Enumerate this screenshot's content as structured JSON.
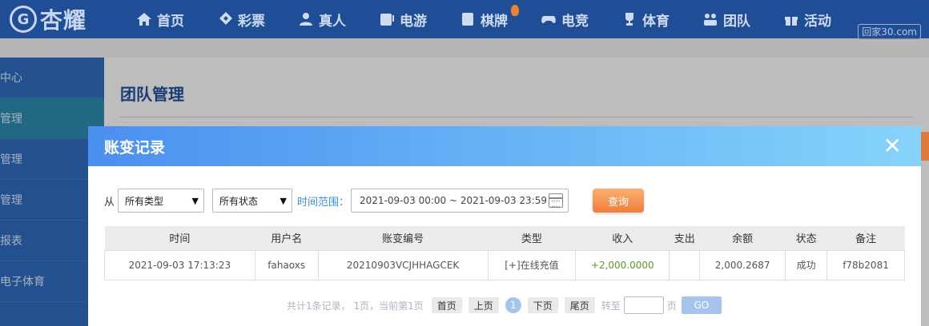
{
  "logo": {
    "text": "杏耀",
    "mark": "G"
  },
  "nav": [
    {
      "label": "首页",
      "icon": "home-icon"
    },
    {
      "label": "彩票",
      "icon": "ticket-icon"
    },
    {
      "label": "真人",
      "icon": "person-icon"
    },
    {
      "label": "电游",
      "icon": "slot-machine-icon"
    },
    {
      "label": "棋牌",
      "icon": "card-icon"
    },
    {
      "label": "电竞",
      "icon": "gamepad-icon"
    },
    {
      "label": "体育",
      "icon": "trophy-icon"
    },
    {
      "label": "团队",
      "icon": "team-icon"
    },
    {
      "label": "活动",
      "icon": "gift-icon"
    }
  ],
  "watermark": "回家30.com",
  "sidebar": {
    "items": [
      {
        "label": "理中心"
      },
      {
        "label": "队管理"
      },
      {
        "label": "人管理"
      },
      {
        "label": "表管理"
      },
      {
        "label": "票报表"
      },
      {
        "label": "人电子体育"
      }
    ]
  },
  "main": {
    "title": "团队管理"
  },
  "modal": {
    "title": "账变记录",
    "close": "✕",
    "filters": {
      "from_label": "从",
      "type_value": "所有类型",
      "status_value": "所有状态",
      "range_label": "时间范围：",
      "date_range": "2021-09-03 00:00 ~ 2021-09-03 23:59",
      "query_label": "查询"
    },
    "table": {
      "columns": [
        "时间",
        "用户名",
        "账变编号",
        "类型",
        "收入",
        "支出",
        "余额",
        "状态",
        "备注"
      ],
      "rows": [
        {
          "time": "2021-09-03 17:13:23",
          "user": "fahaoxs",
          "serial": "20210903VCJHHAGCEK",
          "type": "[+]在线充值",
          "income": "+2,000.0000",
          "expense": "",
          "balance": "2,000.2687",
          "status": "成功",
          "note": "f78b2081"
        }
      ]
    },
    "pager": {
      "info": "共计1条记录， 1页，当前第1页",
      "first": "首页",
      "prev": "上页",
      "current": "1",
      "next": "下页",
      "last": "尾页",
      "goto": "转至",
      "page_word": "页",
      "go": "GO"
    }
  }
}
